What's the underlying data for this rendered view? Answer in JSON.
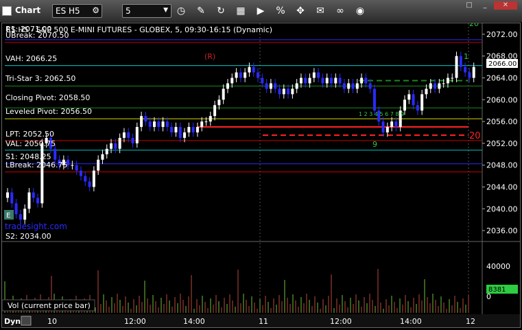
{
  "toolbar": {
    "app_title": "Chart",
    "symbol": "ES H5",
    "interval": "5",
    "icons": [
      "chart-icon",
      "symbol-menu-icon",
      "interval-dropdown-icon",
      "clock-icon",
      "pencil-icon",
      "refresh-icon",
      "tool-icon",
      "play-icon",
      "percent-icon",
      "move-icon",
      "note-icon",
      "link-icon",
      "camera-icon",
      "expand-icon",
      "minimize-icon",
      "close-icon"
    ]
  },
  "chart": {
    "title": "ES H5 - S&P 500 E-MINI FUTURES - GLOBEX, 5, 09:30-16:15 (Dynamic)",
    "last_price": "2066.00",
    "overlay_labels": [
      {
        "text": "R1: 2071.00",
        "color": "#ffffff"
      },
      {
        "text": "UBreak: 2070.50",
        "color": "#ffffff"
      },
      {
        "text": "VAH: 2066.25",
        "color": "#ffffff"
      },
      {
        "text": "Tri-Star 3: 2062.50",
        "color": "#ffffff"
      },
      {
        "text": "Closing Pivot: 2058.50",
        "color": "#ffffff"
      },
      {
        "text": "Leveled Pivot: 2056.50",
        "color": "#ffffff"
      },
      {
        "text": "LPT: 2052.50",
        "color": "#ffffff"
      },
      {
        "text": "VAL: 2050.75",
        "color": "#ffffff"
      },
      {
        "text": "S1: 2048.25",
        "color": "#ffffff"
      },
      {
        "text": "LBreak: 2046.75",
        "color": "#ffffff"
      },
      {
        "text": "S2: 2034.00",
        "color": "#ffffff"
      }
    ],
    "watermark": "tradesight.com",
    "annotations": {
      "r_marker": "(R)",
      "count_top": "20",
      "count_red": "20",
      "count_one": "1",
      "count_nine": "9",
      "count_seq": "1 2 3 4 5 6 7 8 9",
      "badge_e": "E"
    },
    "price_ticks": [
      "2072.00",
      "2068.00",
      "2064.00",
      "2060.00",
      "2056.00",
      "2052.00",
      "2048.00",
      "2044.00",
      "2040.00",
      "2036.00"
    ],
    "volume_ticks": [
      "40000",
      "0"
    ],
    "volume_last": "8381",
    "volume_label": "Vol (current price bar)",
    "time_ticks": [
      "10",
      "12:00",
      "14:00",
      "11",
      "12:00",
      "14:00",
      "12"
    ],
    "mode_label": "Dyn",
    "colors": {
      "up": "#ffffff",
      "down": "#2a2aff",
      "volume": "#b84a3a",
      "volume_up": "#6fbf3a",
      "last_volume": "#2ecc40"
    }
  },
  "chart_data": {
    "type": "candlestick",
    "title": "ES H5 - S&P 500 E-MINI FUTURES - GLOBEX, 5, 09:30-16:15 (Dynamic)",
    "ylim": [
      2034,
      2074
    ],
    "levels": [
      {
        "name": "R1",
        "value": 2071.0,
        "color": "#2a2aff"
      },
      {
        "name": "UBreak",
        "value": 2070.5,
        "color": "#cc0000"
      },
      {
        "name": "VAH",
        "value": 2066.25,
        "color": "#00c8c8"
      },
      {
        "name": "Tri-Star 3",
        "value": 2062.5,
        "color": "#1a8a1a"
      },
      {
        "name": "Closing Pivot",
        "value": 2058.5,
        "color": "#1a8a1a"
      },
      {
        "name": "Leveled Pivot",
        "value": 2056.5,
        "color": "#d8d800"
      },
      {
        "name": "LPT",
        "value": 2052.5,
        "color": "#cc0000"
      },
      {
        "name": "VAL",
        "value": 2050.75,
        "color": "#00c8c8"
      },
      {
        "name": "S1",
        "value": 2048.25,
        "color": "#2a2aff"
      },
      {
        "name": "LBreak",
        "value": 2046.75,
        "color": "#cc0000"
      }
    ],
    "close_series": [
      2043,
      2041,
      2039,
      2038,
      2040,
      2043,
      2042,
      2041,
      2052,
      2053,
      2051,
      2049,
      2048,
      2049,
      2048,
      2048,
      2047,
      2046,
      2045,
      2044,
      2047,
      2049,
      2050,
      2051,
      2052,
      2051,
      2053,
      2054,
      2053,
      2052,
      2055,
      2057,
      2056,
      2055,
      2056,
      2055,
      2056,
      2055,
      2054,
      2055,
      2053,
      2054,
      2055,
      2054,
      2055,
      2056,
      2056,
      2057,
      2059,
      2060,
      2062,
      2063,
      2064,
      2065,
      2064,
      2065,
      2066,
      2065,
      2064,
      2063,
      2062,
      2063,
      2062,
      2061,
      2062,
      2061,
      2062,
      2063,
      2064,
      2063,
      2064,
      2065,
      2064,
      2063,
      2064,
      2063,
      2064,
      2063,
      2062,
      2063,
      2062,
      2063,
      2064,
      2063,
      2062,
      2058,
      2056,
      2054,
      2055,
      2056,
      2055,
      2058,
      2060,
      2061,
      2059,
      2058,
      2061,
      2062,
      2063,
      2062,
      2063,
      2063,
      2064,
      2064,
      2068,
      2066,
      2065,
      2064,
      2066
    ]
  }
}
